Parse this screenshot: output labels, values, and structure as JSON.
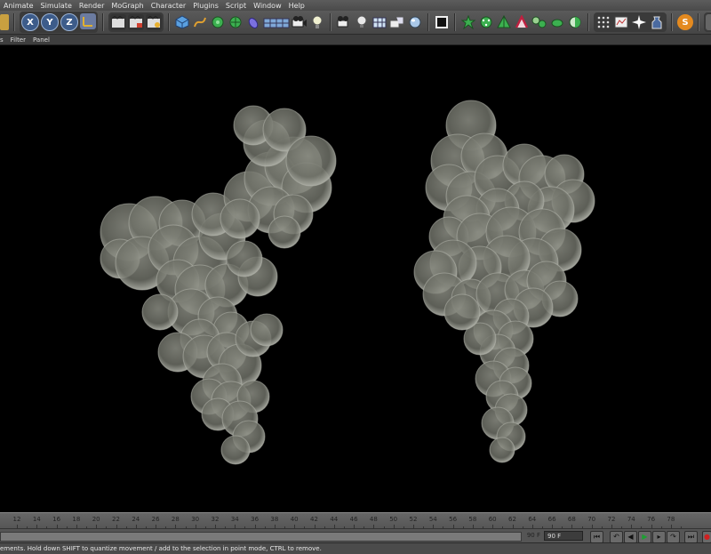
{
  "menu": [
    "Animate",
    "Simulate",
    "Render",
    "MoGraph",
    "Character",
    "Plugins",
    "Script",
    "Window",
    "Help"
  ],
  "submenu": [
    "s",
    "Filter",
    "Panel"
  ],
  "toolbar": {
    "axis_x": "X",
    "axis_y": "Y",
    "axis_z": "Z",
    "script_badge": "S",
    "nav_back": "‹",
    "nav_forward": "›"
  },
  "timeline": {
    "ticks": [
      "12",
      "14",
      "16",
      "18",
      "20",
      "22",
      "24",
      "26",
      "28",
      "30",
      "32",
      "34",
      "36",
      "38",
      "40",
      "42",
      "44",
      "46",
      "48",
      "50",
      "52",
      "54",
      "56",
      "58",
      "60",
      "62",
      "64",
      "66",
      "68",
      "70",
      "72",
      "74",
      "76",
      "78"
    ],
    "end_frame_a": "90 F",
    "end_frame_b": "90 F"
  },
  "status": "ements. Hold down SHIFT to quantize movement / add to the selection in point mode, CTRL to remove.",
  "colors": {
    "smoke": "#7b7d72",
    "smoke_edge": "#b4b6ad",
    "background": "#000000",
    "accent_orange": "#e48a1f"
  }
}
